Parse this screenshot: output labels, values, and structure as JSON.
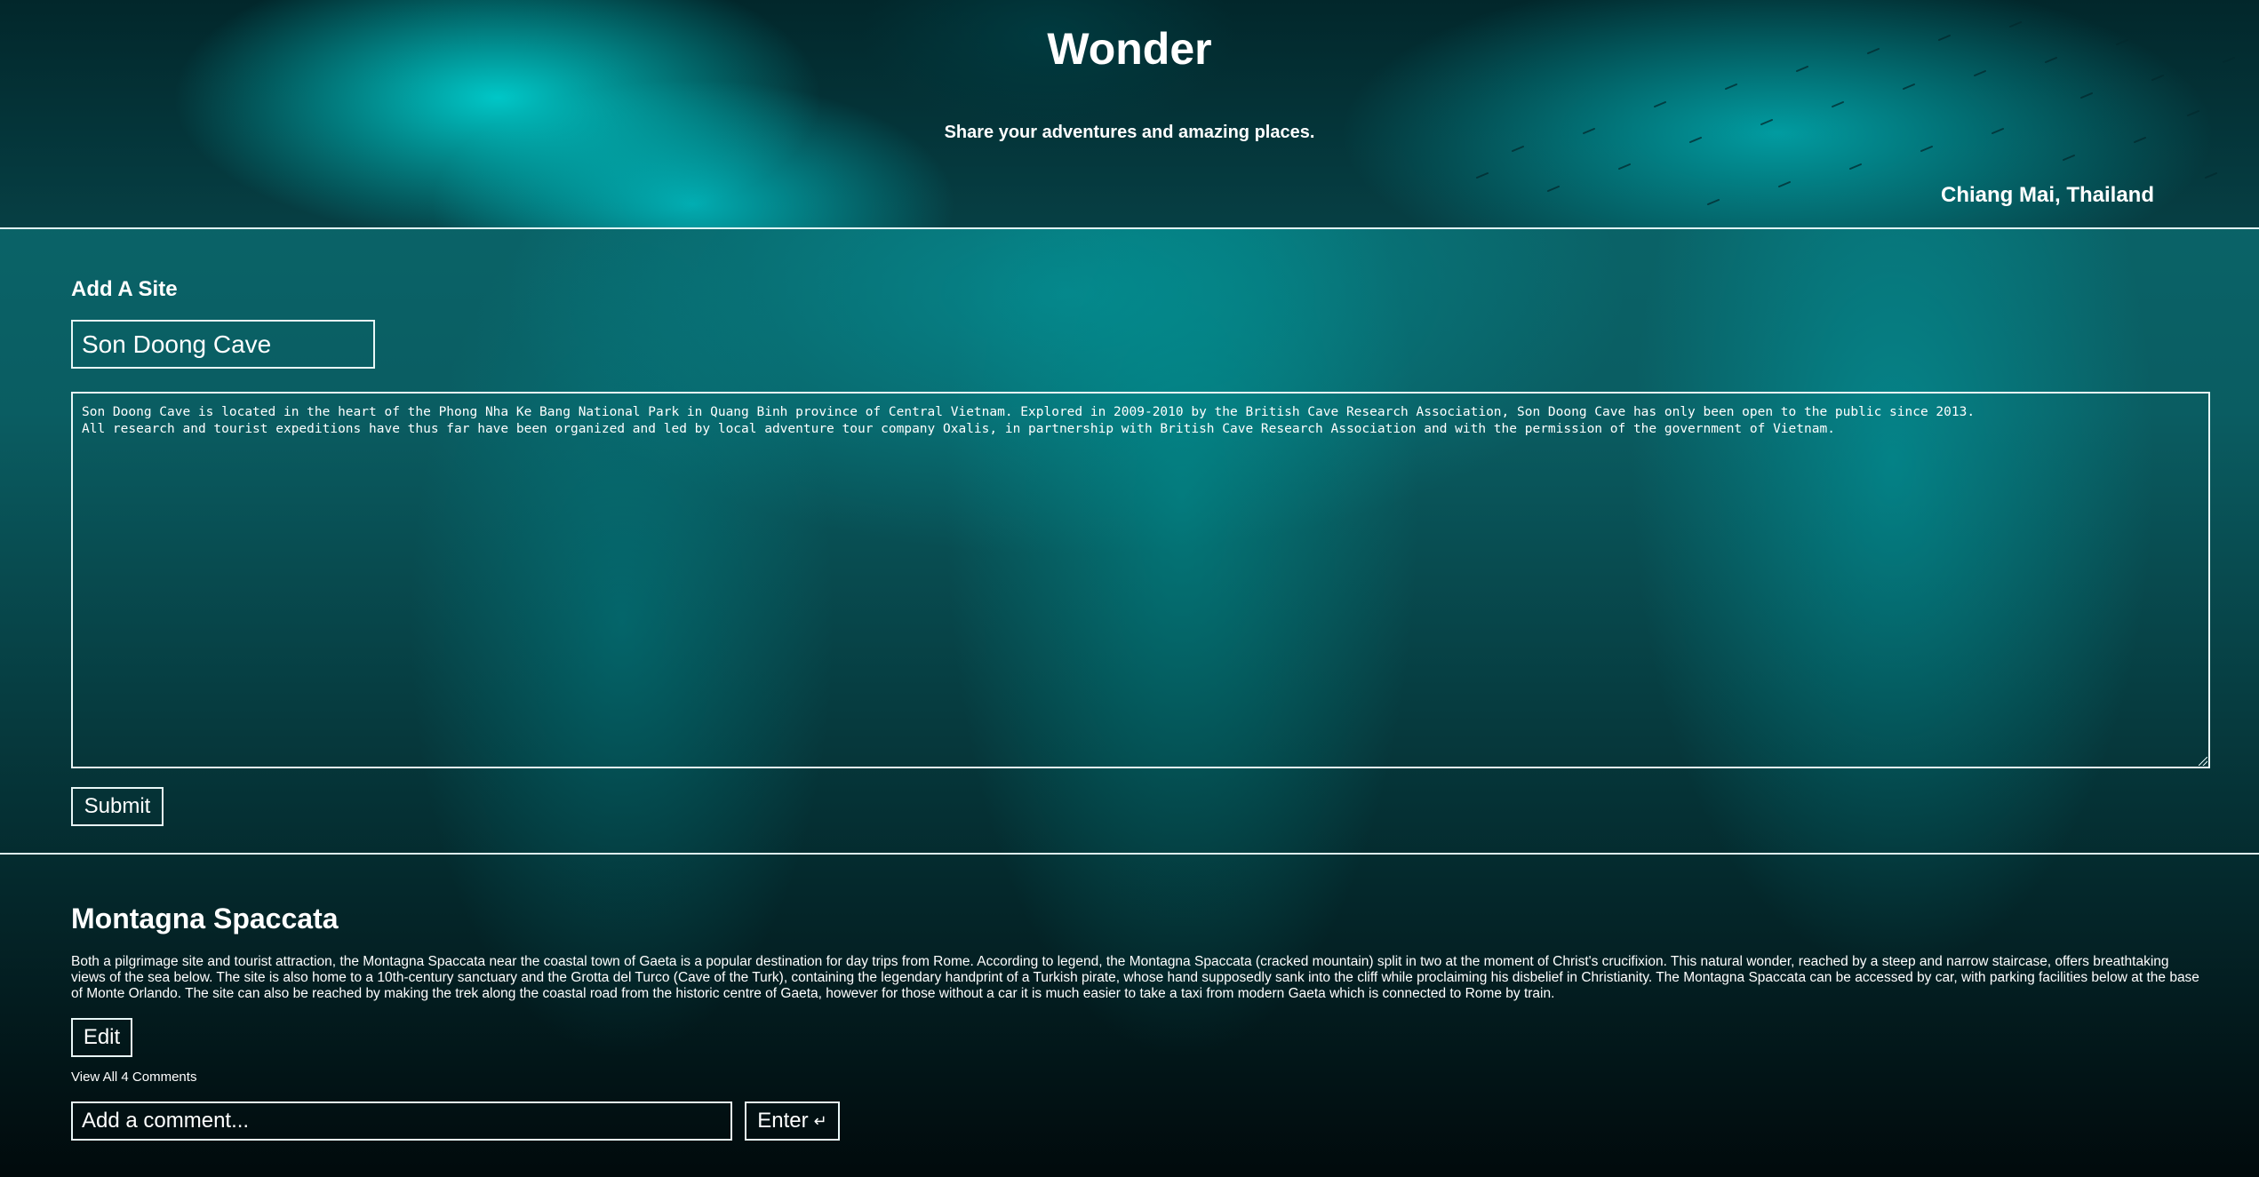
{
  "header": {
    "title": "Wonder",
    "tagline": "Share your adventures and amazing places.",
    "location": "Chiang Mai, Thailand"
  },
  "add_site": {
    "heading": "Add A Site",
    "name_value": "Son Doong Cave",
    "description_value": "Son Doong Cave is located in the heart of the Phong Nha Ke Bang National Park in Quang Binh province of Central Vietnam. Explored in 2009-2010 by the British Cave Research Association, Son Doong Cave has only been open to the public since 2013.\nAll research and tourist expeditions have thus far have been organized and led by local adventure tour company Oxalis, in partnership with British Cave Research Association and with the permission of the government of Vietnam.",
    "submit_label": "Submit"
  },
  "post": {
    "title": "Montagna Spaccata",
    "body": "Both a pilgrimage site and tourist attraction, the Montagna Spaccata near the coastal town of Gaeta is a popular destination for day trips from Rome. According to legend, the Montagna Spaccata (cracked mountain) split in two at the moment of Christ's crucifixion. This natural wonder, reached by a steep and narrow staircase, offers breathtaking views of the sea below. The site is also home to a 10th-century sanctuary and the Grotta del Turco (Cave of the Turk), containing the legendary handprint of a Turkish pirate, whose hand supposedly sank into the cliff while proclaiming his disbelief in Christianity. The Montagna Spaccata can be accessed by car, with parking facilities below at the base of Monte Orlando. The site can also be reached by making the trek along the coastal road from the historic centre of Gaeta, however for those without a car it is much easier to take a taxi from modern Gaeta which is connected to Rome by train.",
    "edit_label": "Edit",
    "view_comments_label": "View All 4 Comments",
    "comment_placeholder": "Add a comment...",
    "enter_label": "Enter",
    "enter_icon": "return-arrow-icon"
  },
  "colors": {
    "accent": "#00c8cc",
    "border": "#e8f7f7",
    "text": "#ffffff"
  }
}
